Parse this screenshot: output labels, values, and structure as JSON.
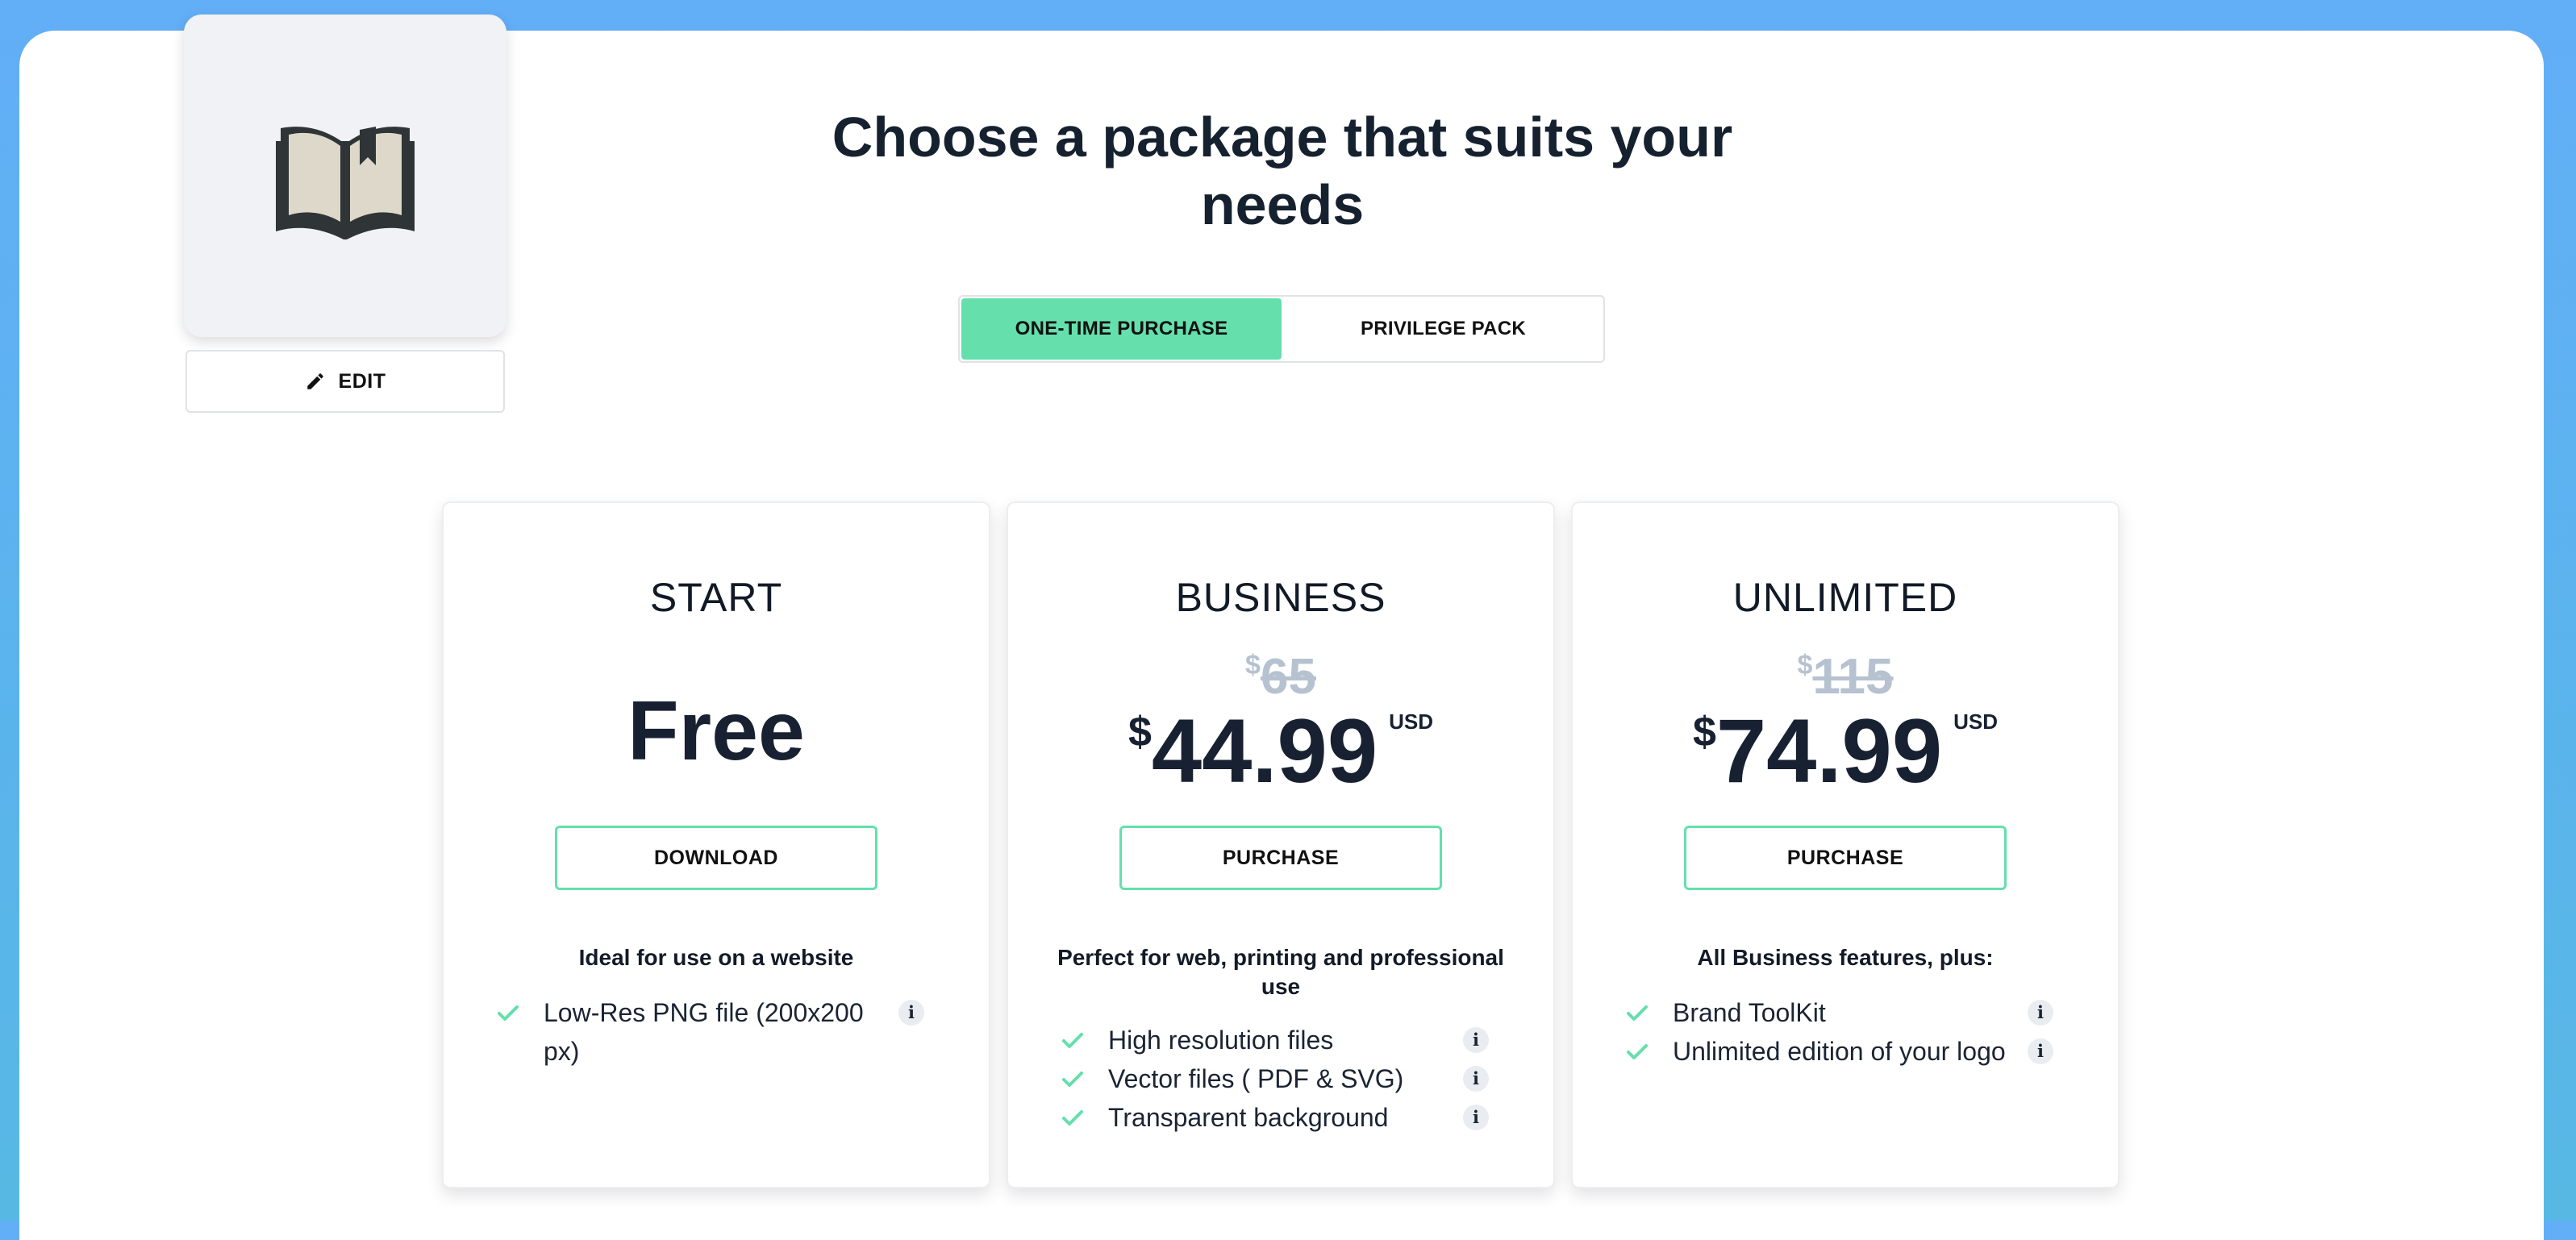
{
  "colors": {
    "accent": "#65dfac",
    "background": "#62aef7",
    "old_price": "#b6c2d0"
  },
  "logo": {
    "icon": "open-book-icon"
  },
  "edit": {
    "icon": "pencil-icon",
    "label": "EDIT"
  },
  "heading": "Choose a package that suits your needs",
  "tabs": {
    "one_time": "ONE-TIME PURCHASE",
    "privilege": "PRIVILEGE PACK",
    "active": "one_time"
  },
  "cards": {
    "start": {
      "title": "START",
      "price": "Free",
      "button": "DOWNLOAD",
      "subtitle": "Ideal for use on a website",
      "features": [
        "Low-Res PNG file (200x200 px)"
      ]
    },
    "business": {
      "title": "BUSINESS",
      "old_currency": "$",
      "old_price": "65",
      "currency": "$",
      "price": "44.99",
      "unit": "USD",
      "button": "PURCHASE",
      "subtitle": "Perfect for web, printing and professional use",
      "features": [
        "High resolution files",
        "Vector files ( PDF & SVG)",
        "Transparent background"
      ]
    },
    "unlimited": {
      "title": "UNLIMITED",
      "old_currency": "$",
      "old_price": "115",
      "currency": "$",
      "price": "74.99",
      "unit": "USD",
      "button": "PURCHASE",
      "subtitle": "All Business features, plus:",
      "features": [
        "Brand ToolKit",
        "Unlimited edition of your logo"
      ]
    }
  }
}
